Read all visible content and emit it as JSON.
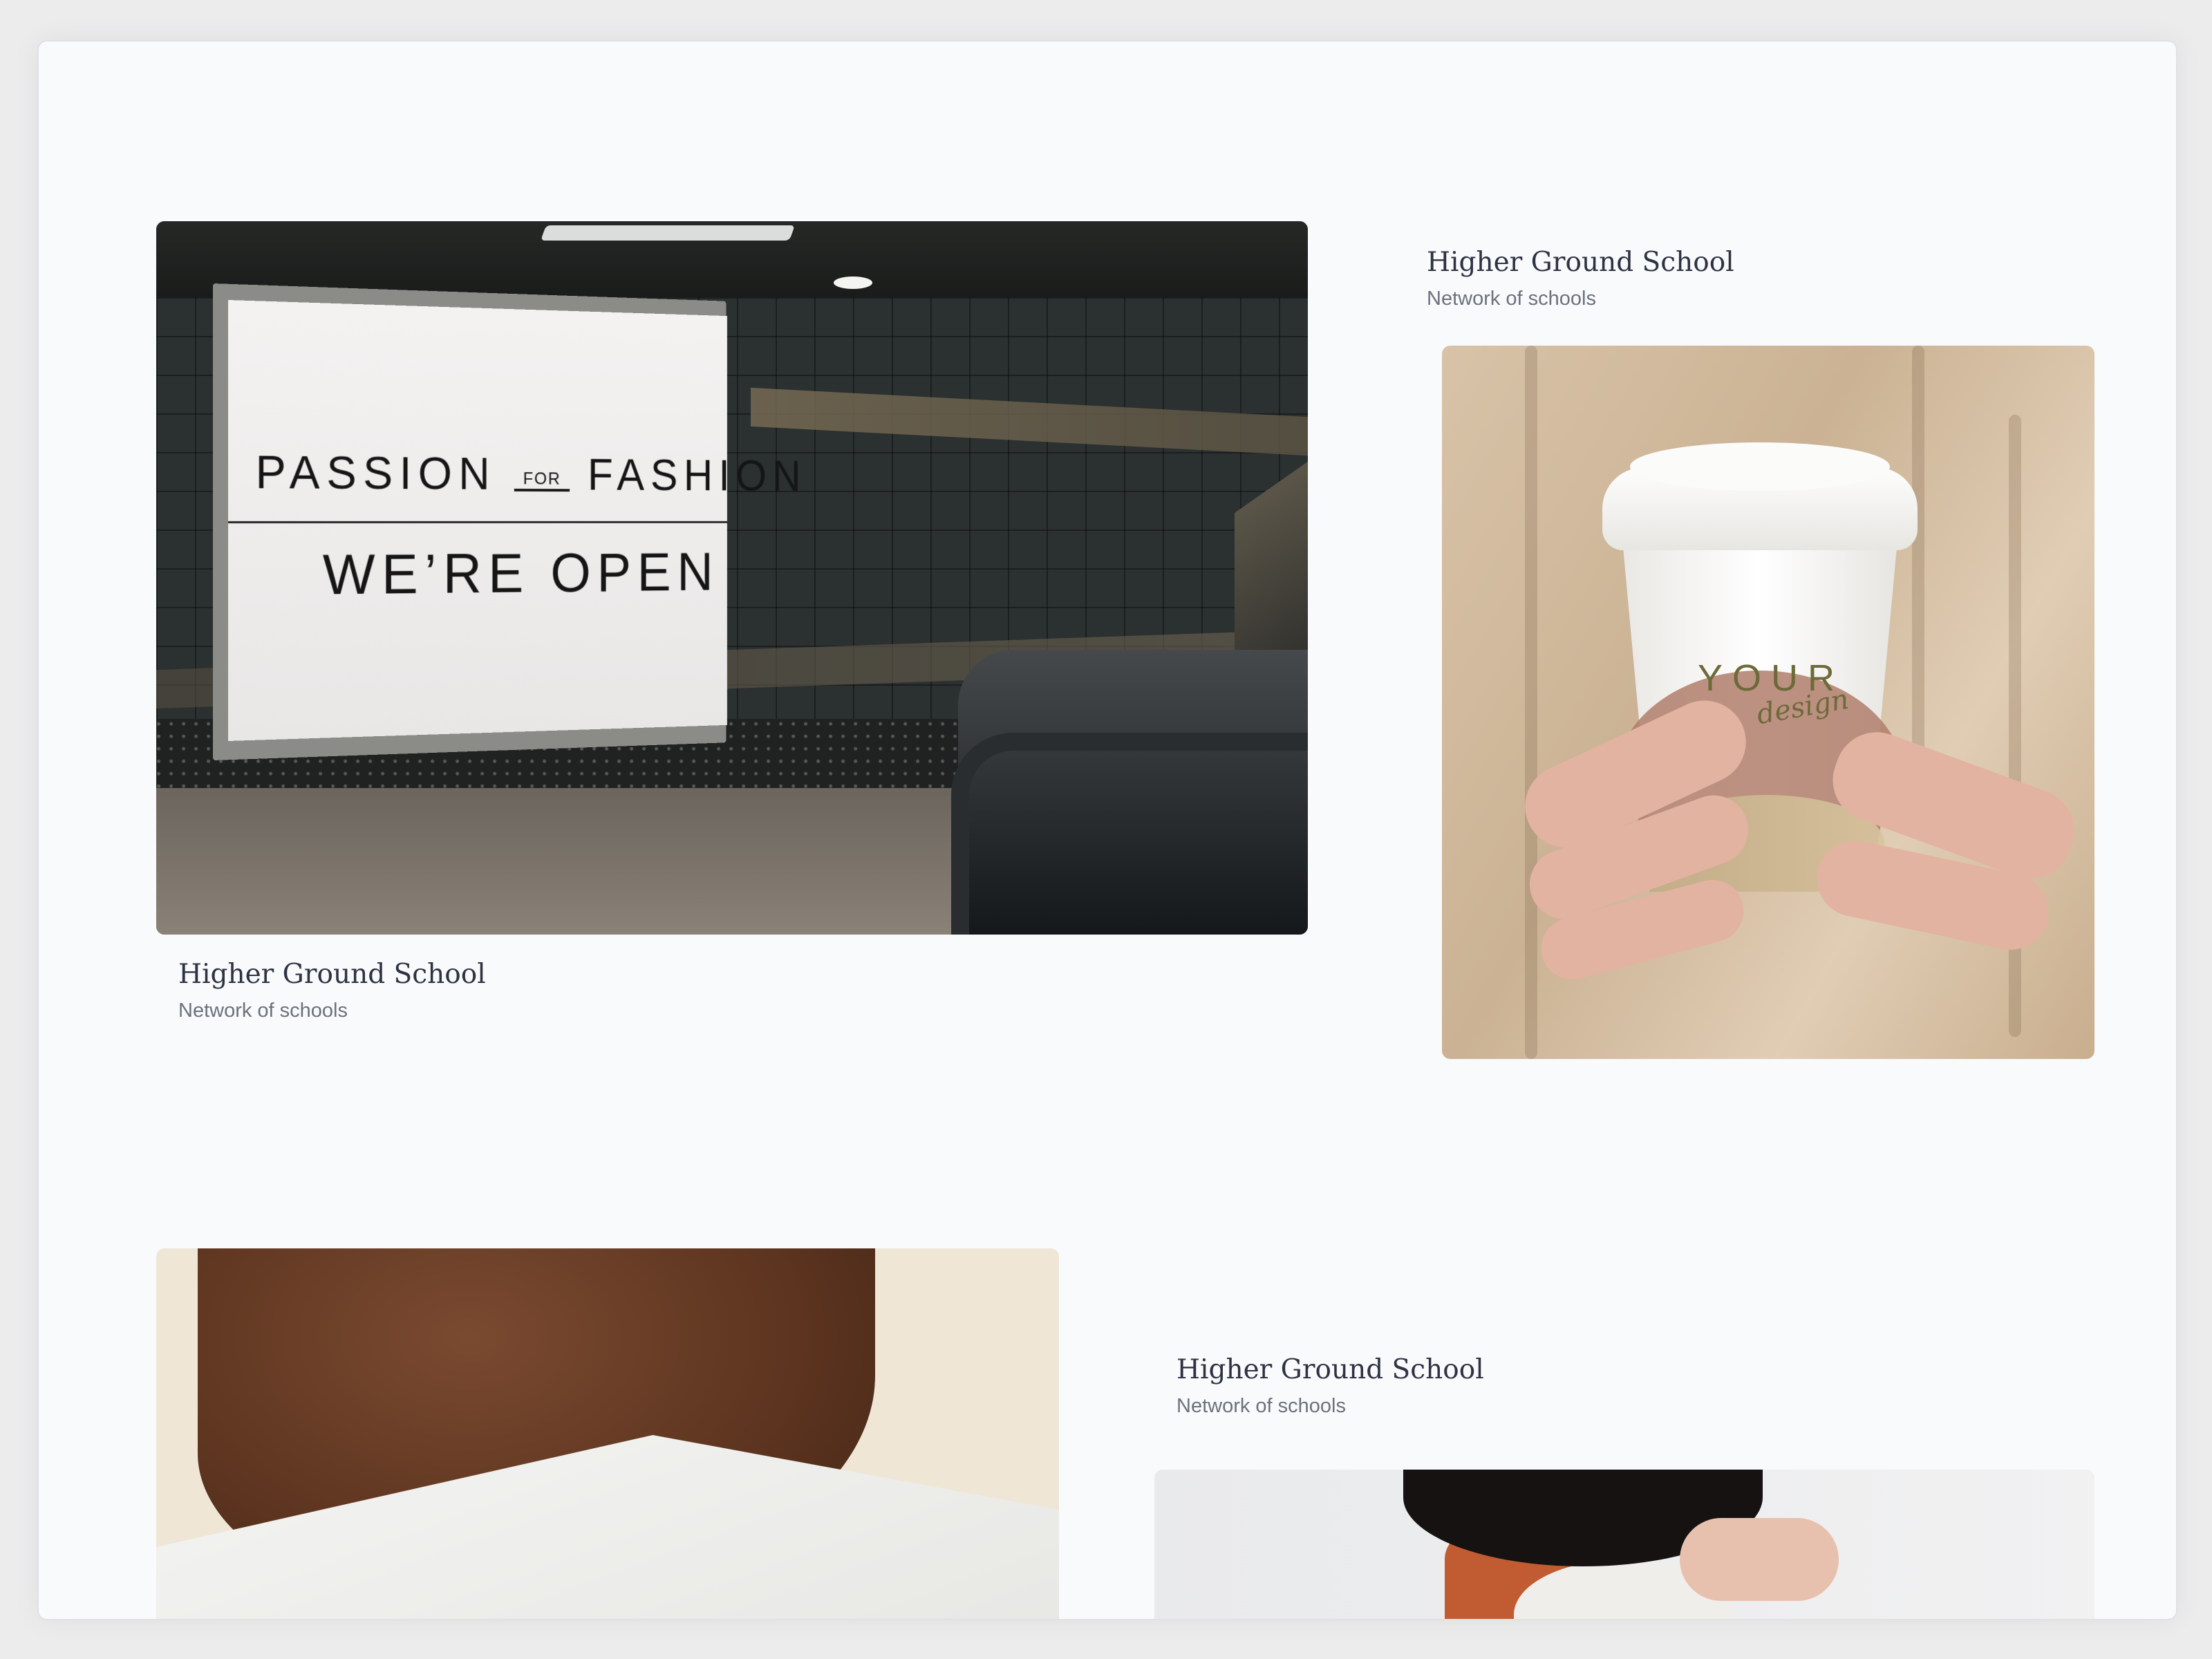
{
  "projects": [
    {
      "title": "Higher Ground School",
      "subtitle": "Network of schools"
    },
    {
      "title": "Higher Ground School",
      "subtitle": "Network of schools"
    },
    {
      "title": "Higher Ground School",
      "subtitle": "Network of schools"
    }
  ],
  "billboard": {
    "word1": "PASSION",
    "word_small": "FOR",
    "word2": "FASHION",
    "line2": "WE’RE OPEN"
  },
  "cup": {
    "brand": "YOUR",
    "script": "design"
  },
  "colors": {
    "page_background": "#f9fafc",
    "title_text": "#2d3342",
    "subtitle_text": "#6b717d"
  }
}
